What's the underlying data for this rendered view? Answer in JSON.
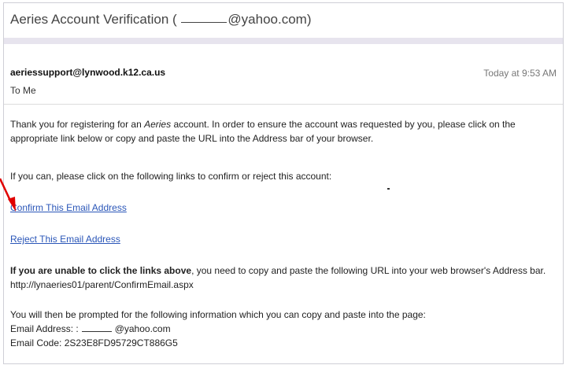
{
  "email": {
    "subject_prefix": "Aeries Account Verification (",
    "subject_suffix": "@yahoo.com)",
    "sender": "aeriessupport@lynwood.k12.ca.us",
    "timestamp": "Today at 9:53 AM",
    "to_line": "To  Me",
    "para1_a": "Thank you for registering for an ",
    "para1_em": "Aeries",
    "para1_b": " account. In order to ensure the account was requested by you, please click on the appropriate link below or copy and paste the URL into the Address bar of your browser.",
    "para2": "If you can, please click on the following links to confirm or reject this account:",
    "confirm_link": "Confirm This Email Address",
    "reject_link": "Reject This Email Address",
    "para3_bold": "If you are unable to click the links above",
    "para3_rest": ", you need to copy and paste the following URL into your web browser's Address bar.",
    "url": "http://lynaeries01/parent/ConfirmEmail.aspx",
    "para4": "You will then be prompted for the following information which you can copy and paste into the page:",
    "email_address_label": "Email Address: :",
    "email_address_value": "@yahoo.com",
    "email_code_label": "Email Code: ",
    "email_code_value": "2S23E8FD95729CT886G5"
  },
  "colors": {
    "link": "#2a56b8",
    "arrow": "#e00000",
    "divider": "#e7e4ee"
  }
}
